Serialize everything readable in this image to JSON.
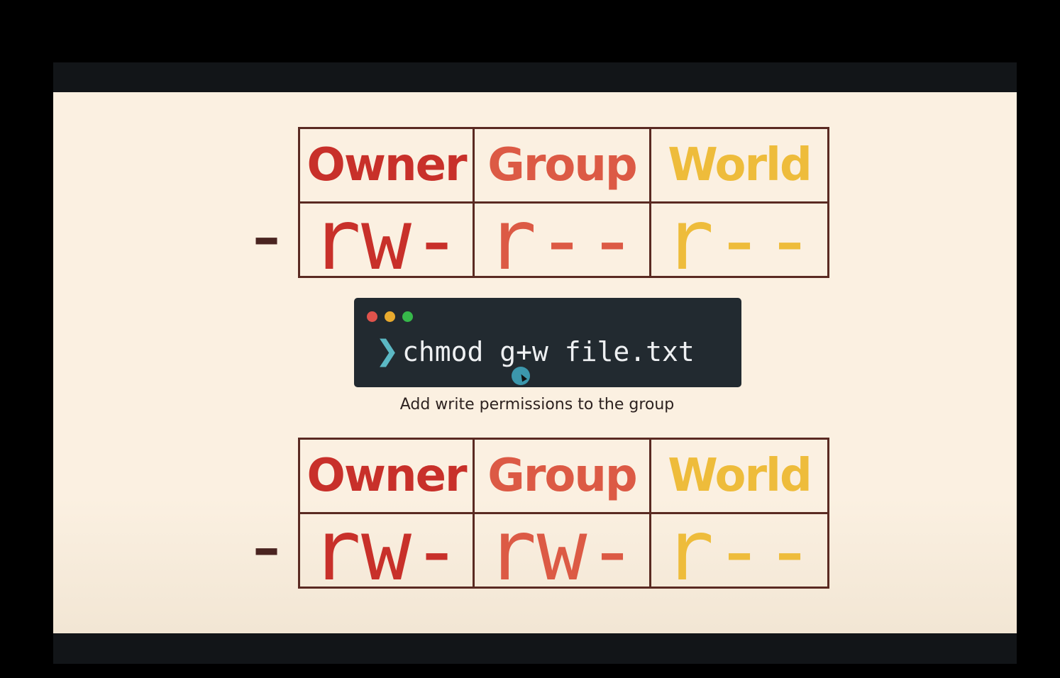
{
  "tables": [
    {
      "headers": [
        "Owner",
        "Group",
        "World"
      ],
      "type_char": "-",
      "owner": [
        "r",
        "w",
        "-"
      ],
      "group": [
        "r",
        "-",
        "-"
      ],
      "world": [
        "r",
        "-",
        "-"
      ]
    },
    {
      "headers": [
        "Owner",
        "Group",
        "World"
      ],
      "type_char": "-",
      "owner": [
        "r",
        "w",
        "-"
      ],
      "group": [
        "r",
        "w",
        "-"
      ],
      "world": [
        "r",
        "-",
        "-"
      ]
    }
  ],
  "terminal": {
    "prompt": "❯",
    "command": "chmod g+w file.txt",
    "dot_colors": [
      "#e0534c",
      "#e8aa2e",
      "#36b84a"
    ]
  },
  "caption": "Add write permissions to the group",
  "colors": {
    "owner": "#c8302a",
    "group": "#dc5a45",
    "world": "#eebc3b",
    "type": "#4a2420",
    "border": "#5a2a22"
  }
}
